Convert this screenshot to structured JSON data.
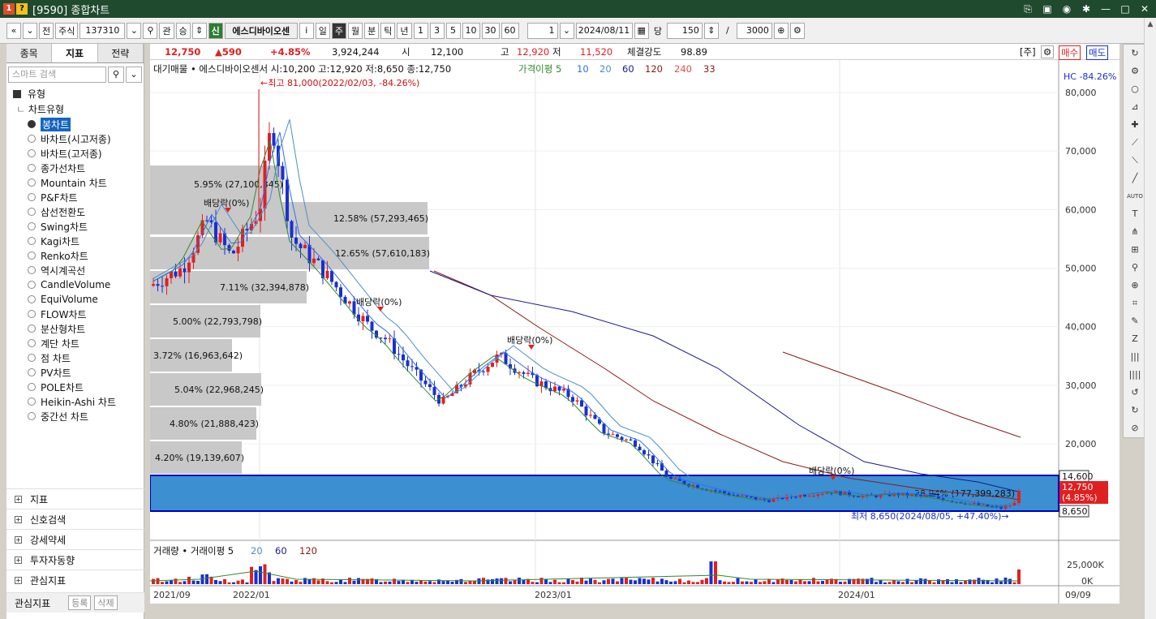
{
  "window": {
    "title": "[9590] 종합차트"
  },
  "toolbar": {
    "nav": [
      "«",
      "⌄",
      "전"
    ],
    "stock_type": "주식",
    "code": "137310",
    "lookup": [
      "관",
      "승"
    ],
    "new_badge": "신",
    "stock_name": "에스디바이오센",
    "periods": [
      "일",
      "주",
      "월",
      "분",
      "틱",
      "년"
    ],
    "selected_period": "주",
    "nums": [
      "1",
      "3",
      "5",
      "10",
      "30",
      "60"
    ],
    "count": "1",
    "date": "2024/08/11",
    "dang": "당",
    "bars": "150",
    "slash": "/",
    "total": "3000"
  },
  "left": {
    "tabs": [
      "종목",
      "지표",
      "전략"
    ],
    "active_tab": "지표",
    "search_placeholder": "스마트 검색",
    "section_type": "유형",
    "subsection": "차트유형",
    "chart_types": [
      "봉차트",
      "바차트(시고저종)",
      "바차트(고저종)",
      "종가선차트",
      "Mountain 차트",
      "P&F차트",
      "삼선전환도",
      "Swing차트",
      "Kagi차트",
      "Renko차트",
      "역시계곡선",
      "CandleVolume",
      "EquiVolume",
      "FLOW차트",
      "분산형차트",
      "계단 차트",
      "점 차트",
      "PV차트",
      "POLE차트",
      "Heikin-Ashi 차트",
      "중간선 차트"
    ],
    "selected_type": "봉차트",
    "bottom_sections": [
      "지표",
      "신호검색",
      "강세약세",
      "투자자동향",
      "관심지표"
    ],
    "fav_label": "관심지표",
    "fav_buttons": [
      "등록",
      "삭제"
    ]
  },
  "price": {
    "current": "12,750",
    "change": "▲590",
    "change_pct": "+4.85%",
    "volume": "3,924,244",
    "open_label": "시",
    "open": "12,100",
    "high_label": "고",
    "high": "12,920",
    "low_label": "저",
    "low": "11,520",
    "strength_label": "체결강도",
    "strength": "98.89",
    "unit": "[주]",
    "buy": "매수",
    "sell": "매도"
  },
  "chart": {
    "legend_main": "대기매물 • 에스디바이오센서 시:10,200 고:12,920 저:8,650 종:12,750",
    "legend_ma_label": "가격이평 5",
    "legend_ma": [
      "10",
      "20",
      "60",
      "120",
      "240",
      "33"
    ],
    "max_note": "←최고 81,000(2022/02/03, -84.26%)",
    "min_note": "최저 8,650(2024/08/05, +47.40%)→",
    "hc_note": "HC -84.26%",
    "dividend": "배당락(0%)",
    "y_ticks": [
      "80,000",
      "70,000",
      "60,000",
      "50,000",
      "40,000",
      "30,000",
      "20,000"
    ],
    "x_ticks": [
      "2021/09",
      "2022/01",
      "2023/01",
      "2024/01",
      "09/09"
    ],
    "box_labels": [
      "5.95% (27,100,345)",
      "12.58% (57,293,465)",
      "12.65% (57,610,183)",
      "7.11% (32,394,878)",
      "5.00% (22,793,798)",
      "3.72% (16,963,642)",
      "5.04% (22,968,245)",
      "4.80% (21,888,423)",
      "4.20% (19,139,607)",
      "28.94% (177,399,283)"
    ],
    "right_labels": [
      "14,600",
      "12,750",
      "(4.85%)",
      "8,650"
    ],
    "vol_legend": "거래량 • 거래이평 5",
    "vol_legend_ma": [
      "20",
      "60",
      "120"
    ],
    "vol_ticks": [
      "25,000K",
      "0K"
    ]
  },
  "colors": {
    "up": "#e02020",
    "down": "#1a2fd0",
    "ma5": "#2e8b2e",
    "ma10": "#2f6ff0",
    "ma60": "#1a1a8c",
    "ma120": "#8b1a1a",
    "box": "#c8c8c8",
    "highlight": "#3c8fd0"
  }
}
